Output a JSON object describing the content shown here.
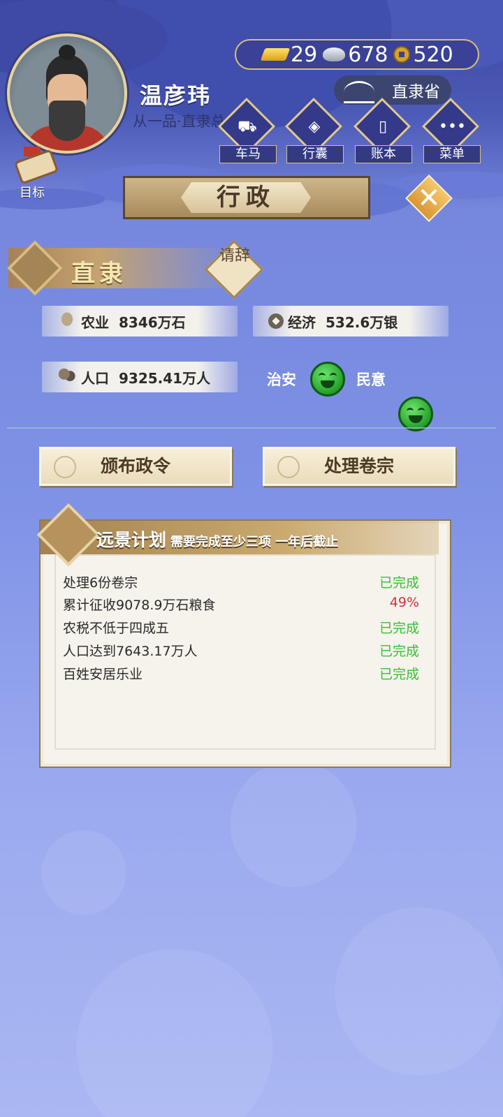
{
  "player": {
    "name": "温彦玮",
    "rank": "从一品·直隶总"
  },
  "currency": {
    "gold": "29",
    "silver": "678",
    "coins": "520"
  },
  "region": "直隶省",
  "menu": [
    {
      "label": "车马",
      "icon": "carriage-icon"
    },
    {
      "label": "行囊",
      "icon": "bag-icon"
    },
    {
      "label": "账本",
      "icon": "ledger-icon"
    },
    {
      "label": "菜单",
      "icon": "more-icon"
    }
  ],
  "goal_label": "目标",
  "title": "行政",
  "province": {
    "name": "直隶",
    "resign": "请辞"
  },
  "stats": {
    "agriculture": {
      "label": "农业",
      "value": "8346万石"
    },
    "economy": {
      "label": "经济",
      "value": "532.6万银"
    },
    "population": {
      "label": "人口",
      "value": "9325.41万人"
    },
    "security_label": "治安",
    "morale_label": "民意"
  },
  "actions": {
    "decree": "颁布政令",
    "files": "处理卷宗"
  },
  "plan": {
    "title": "远景计划",
    "subtitle": "需要完成至少三项 一年后截止",
    "items": [
      {
        "task": "处理6份卷宗",
        "status": "已完成",
        "done": true
      },
      {
        "task": "累计征收9078.9万石粮食",
        "status": "49%",
        "done": false
      },
      {
        "task": "农税不低于四成五",
        "status": "已完成",
        "done": true
      },
      {
        "task": "人口达到7643.17万人",
        "status": "已完成",
        "done": true
      },
      {
        "task": "百姓安居乐业",
        "status": "已完成",
        "done": true
      }
    ]
  }
}
